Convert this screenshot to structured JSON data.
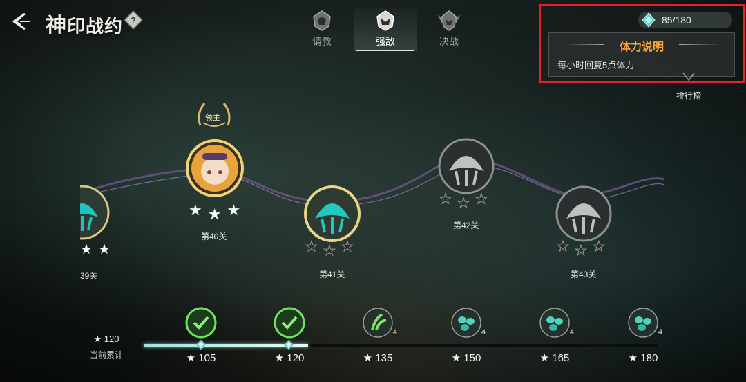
{
  "header": {
    "title_first": "神",
    "title_rest": "印战约",
    "help_label": "?",
    "tabs": [
      {
        "label": "请教",
        "active": false
      },
      {
        "label": "强敌",
        "active": true
      },
      {
        "label": "决战",
        "active": false
      }
    ]
  },
  "stamina": {
    "value": "85/180",
    "current": 85,
    "max": 180
  },
  "tooltip": {
    "title": "体力说明",
    "body": "每小时回复5点体力"
  },
  "rank": {
    "label": "排行榜"
  },
  "stages": [
    {
      "name": "39关",
      "stars": 3,
      "earned": 3,
      "state": "cleared"
    },
    {
      "name": "第40关",
      "stars": 3,
      "earned": 3,
      "state": "cleared",
      "badge": "领主"
    },
    {
      "name": "第41关",
      "stars": 3,
      "earned": 0,
      "state": "current"
    },
    {
      "name": "第42关",
      "stars": 3,
      "earned": 0,
      "state": "locked"
    },
    {
      "name": "第43关",
      "stars": 3,
      "earned": 0,
      "state": "locked"
    }
  ],
  "progress": {
    "current_label": "当前累计",
    "current_value": "120",
    "current": 120,
    "fill_fraction": 0.32,
    "rewards": [
      {
        "threshold": "105",
        "count": "",
        "type": "grass",
        "claimed": true
      },
      {
        "threshold": "120",
        "count": "",
        "type": "grass",
        "claimed": true
      },
      {
        "threshold": "135",
        "count": "4",
        "type": "grass",
        "claimed": false
      },
      {
        "threshold": "150",
        "count": "4",
        "type": "eggs",
        "claimed": false
      },
      {
        "threshold": "165",
        "count": "4",
        "type": "eggs",
        "claimed": false
      },
      {
        "threshold": "180",
        "count": "4",
        "type": "eggs",
        "claimed": false
      }
    ]
  },
  "colors": {
    "accent": "#f4a63c",
    "highlight": "#e02424",
    "progress": "#9ee4e0"
  }
}
